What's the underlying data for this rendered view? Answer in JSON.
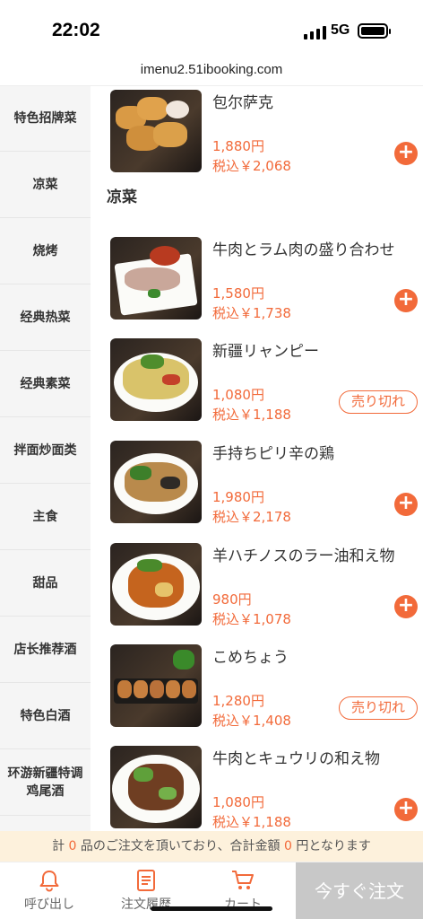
{
  "status": {
    "time": "22:02",
    "network": "5G"
  },
  "browser": {
    "url": "imenu2.51ibooking.com"
  },
  "sidebar": {
    "categories": [
      "特色招牌菜",
      "凉菜",
      "烧烤",
      "经典热菜",
      "经典素菜",
      "拌面炒面类",
      "主食",
      "甜品",
      "店长推荐酒",
      "特色白酒",
      "环游新疆特调鸡尾酒"
    ]
  },
  "menu": {
    "section_title": "凉菜",
    "sold_out_label": "売り切れ",
    "add_label": "+",
    "items": [
      {
        "name": "包尔萨克",
        "price": "1,880円",
        "tax_price": "税込￥2,068",
        "status": "add"
      },
      {
        "name": "牛肉とラム肉の盛り合わせ",
        "price": "1,580円",
        "tax_price": "税込￥1,738",
        "status": "add"
      },
      {
        "name": "新疆リャンピー",
        "price": "1,080円",
        "tax_price": "税込￥1,188",
        "status": "sold_out"
      },
      {
        "name": "手持ちピリ辛の鶏",
        "price": "1,980円",
        "tax_price": "税込￥2,178",
        "status": "add"
      },
      {
        "name": "羊ハチノスのラー油和え物",
        "price": "980円",
        "tax_price": "税込￥1,078",
        "status": "add"
      },
      {
        "name": "こめちょう",
        "price": "1,280円",
        "tax_price": "税込￥1,408",
        "status": "sold_out"
      },
      {
        "name": "牛肉とキュウリの和え物",
        "price": "1,080円",
        "tax_price": "税込￥1,188",
        "status": "add"
      }
    ]
  },
  "notice": {
    "prefix": "計",
    "count": "0",
    "middle": "品のご注文を頂いており、合計金額",
    "amount": "0",
    "suffix": "円となります"
  },
  "bottom_nav": {
    "call_label": "呼び出し",
    "history_label": "注文履歴",
    "cart_label": "カート",
    "order_button": "今すぐ注文"
  },
  "colors": {
    "accent": "#f26a3a",
    "notice_bg": "#fdf1dc",
    "order_button_bg": "#c8c8c8"
  }
}
